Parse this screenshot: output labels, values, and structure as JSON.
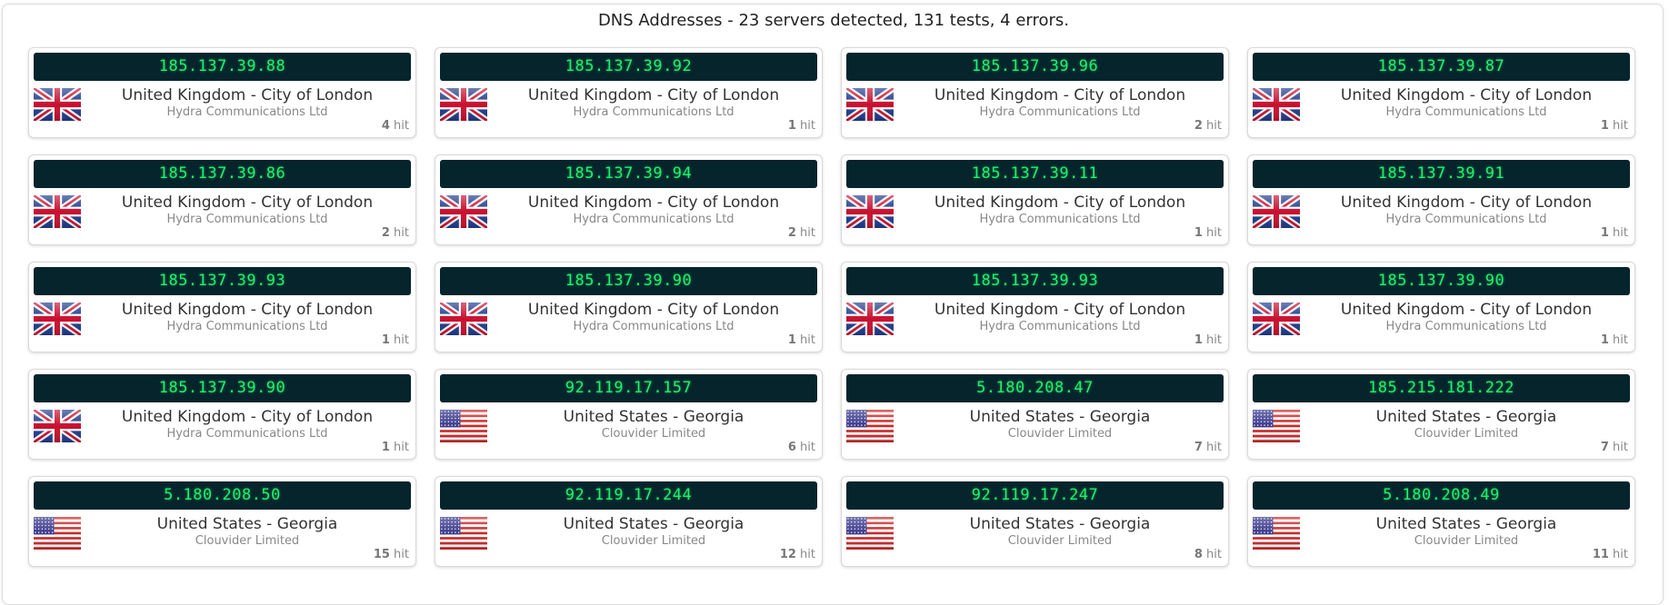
{
  "header": {
    "title": "DNS Addresses - 23 servers detected, 131 tests, 4 errors."
  },
  "servers": [
    {
      "ip": "185.137.39.88",
      "location": "United Kingdom - City of London",
      "isp": "Hydra Communications Ltd",
      "hits": "4",
      "hit_label": "hit",
      "flag": "uk-flag-icon"
    },
    {
      "ip": "185.137.39.92",
      "location": "United Kingdom - City of London",
      "isp": "Hydra Communications Ltd",
      "hits": "1",
      "hit_label": "hit",
      "flag": "uk-flag-icon"
    },
    {
      "ip": "185.137.39.96",
      "location": "United Kingdom - City of London",
      "isp": "Hydra Communications Ltd",
      "hits": "2",
      "hit_label": "hit",
      "flag": "uk-flag-icon"
    },
    {
      "ip": "185.137.39.87",
      "location": "United Kingdom - City of London",
      "isp": "Hydra Communications Ltd",
      "hits": "1",
      "hit_label": "hit",
      "flag": "uk-flag-icon"
    },
    {
      "ip": "185.137.39.86",
      "location": "United Kingdom - City of London",
      "isp": "Hydra Communications Ltd",
      "hits": "2",
      "hit_label": "hit",
      "flag": "uk-flag-icon"
    },
    {
      "ip": "185.137.39.94",
      "location": "United Kingdom - City of London",
      "isp": "Hydra Communications Ltd",
      "hits": "2",
      "hit_label": "hit",
      "flag": "uk-flag-icon"
    },
    {
      "ip": "185.137.39.11",
      "location": "United Kingdom - City of London",
      "isp": "Hydra Communications Ltd",
      "hits": "1",
      "hit_label": "hit",
      "flag": "uk-flag-icon"
    },
    {
      "ip": "185.137.39.91",
      "location": "United Kingdom - City of London",
      "isp": "Hydra Communications Ltd",
      "hits": "1",
      "hit_label": "hit",
      "flag": "uk-flag-icon"
    },
    {
      "ip": "185.137.39.93",
      "location": "United Kingdom - City of London",
      "isp": "Hydra Communications Ltd",
      "hits": "1",
      "hit_label": "hit",
      "flag": "uk-flag-icon"
    },
    {
      "ip": "185.137.39.90",
      "location": "United Kingdom - City of London",
      "isp": "Hydra Communications Ltd",
      "hits": "1",
      "hit_label": "hit",
      "flag": "uk-flag-icon"
    },
    {
      "ip": "185.137.39.93",
      "location": "United Kingdom - City of London",
      "isp": "Hydra Communications Ltd",
      "hits": "1",
      "hit_label": "hit",
      "flag": "uk-flag-icon"
    },
    {
      "ip": "185.137.39.90",
      "location": "United Kingdom - City of London",
      "isp": "Hydra Communications Ltd",
      "hits": "1",
      "hit_label": "hit",
      "flag": "uk-flag-icon"
    },
    {
      "ip": "185.137.39.90",
      "location": "United Kingdom - City of London",
      "isp": "Hydra Communications Ltd",
      "hits": "1",
      "hit_label": "hit",
      "flag": "uk-flag-icon"
    },
    {
      "ip": "92.119.17.157",
      "location": "United States - Georgia",
      "isp": "Clouvider Limited",
      "hits": "6",
      "hit_label": "hit",
      "flag": "us-flag-icon"
    },
    {
      "ip": "5.180.208.47",
      "location": "United States - Georgia",
      "isp": "Clouvider Limited",
      "hits": "7",
      "hit_label": "hit",
      "flag": "us-flag-icon"
    },
    {
      "ip": "185.215.181.222",
      "location": "United States - Georgia",
      "isp": "Clouvider Limited",
      "hits": "7",
      "hit_label": "hit",
      "flag": "us-flag-icon"
    },
    {
      "ip": "5.180.208.50",
      "location": "United States - Georgia",
      "isp": "Clouvider Limited",
      "hits": "15",
      "hit_label": "hit",
      "flag": "us-flag-icon"
    },
    {
      "ip": "92.119.17.244",
      "location": "United States - Georgia",
      "isp": "Clouvider Limited",
      "hits": "12",
      "hit_label": "hit",
      "flag": "us-flag-icon"
    },
    {
      "ip": "92.119.17.247",
      "location": "United States - Georgia",
      "isp": "Clouvider Limited",
      "hits": "8",
      "hit_label": "hit",
      "flag": "us-flag-icon"
    },
    {
      "ip": "5.180.208.49",
      "location": "United States - Georgia",
      "isp": "Clouvider Limited",
      "hits": "11",
      "hit_label": "hit",
      "flag": "us-flag-icon"
    }
  ],
  "colors": {
    "ip_background": "#05242c",
    "ip_text": "#22f06a"
  }
}
